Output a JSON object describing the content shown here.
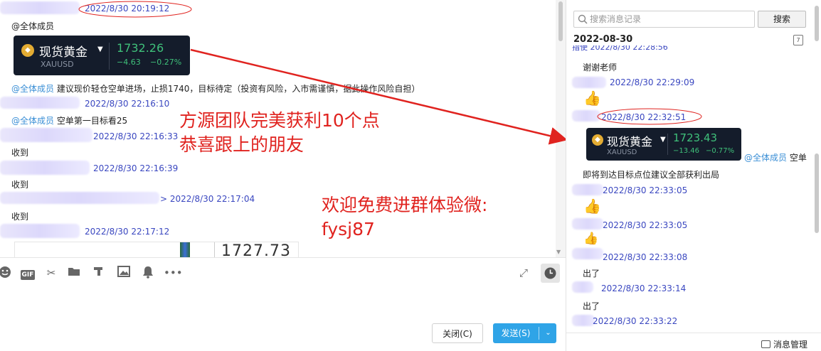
{
  "chat": {
    "messages": [
      {
        "time": "2022/8/30 20:19:12",
        "mention": "@全体成员"
      },
      {
        "mention": "@全体成员",
        "text": "建议现价轻仓空单进场，止损1740，目标待定（投资有风险，入市需谨慎，据此操作风险自担）",
        "time": "2022/8/30 22:16:10"
      },
      {
        "mention": "@全体成员",
        "text": "空单第一目标看25"
      },
      {
        "time": "2022/8/30 22:16:33",
        "text": "收到"
      },
      {
        "time": "2022/8/30 22:16:39",
        "text": "收到"
      },
      {
        "time": "> 2022/8/30 22:17:04",
        "text": "收到"
      },
      {
        "time": "2022/8/30 22:17:12",
        "partial_price": "1727.73"
      }
    ],
    "quote_card": {
      "name": "现货黄金",
      "symbol": "XAUUSD",
      "price": "1732.26",
      "change": "−4.63",
      "change_pct": "−0.27%"
    }
  },
  "overlay": {
    "line1": "方源团队完美获利10个点",
    "line2": "恭喜跟上的朋友",
    "line3": "欢迎免费进群体验微:",
    "line4": "fysj87"
  },
  "toolbar": {
    "icons": [
      "emoji-icon",
      "gif-icon",
      "scissors-icon",
      "folder-icon",
      "rich-text-icon",
      "image-icon",
      "bell-icon",
      "more-icon"
    ],
    "gif_label": "GIF"
  },
  "buttons": {
    "close": "关闭(C)",
    "send": "发送(S)"
  },
  "history": {
    "search_placeholder": "搜索消息记录",
    "search_button": "搜索",
    "date": "2022-08-30",
    "calendar_day": "7",
    "partial_top": "指使 2022/8/30 22:28:56",
    "messages": [
      {
        "text": "谢谢老师"
      },
      {
        "time": "2022/8/30 22:29:09",
        "emoji": "👍"
      },
      {
        "time": "2022/8/30 22:32:51"
      },
      {
        "mention": "@全体成员",
        "text": "空单",
        "text2": "即将到达目标点位建议全部获利出局"
      },
      {
        "time": "2022/8/30 22:33:05",
        "emoji": "👍"
      },
      {
        "time": "2022/8/30 22:33:05",
        "emoji": "👍"
      },
      {
        "time": "2022/8/30 22:33:08",
        "text": "出了"
      },
      {
        "time": "2022/8/30 22:33:14",
        "text": "出了"
      },
      {
        "time": "2022/8/30 22:33:22"
      }
    ],
    "quote_card": {
      "name": "现货黄金",
      "symbol": "XAUUSD",
      "price": "1723.43",
      "change": "−13.46",
      "change_pct": "−0.77%"
    },
    "message_manager": "消息管理"
  },
  "colors": {
    "accent_blue": "#2fa4e7",
    "annotation_red": "#e0231f",
    "price_green": "#3fc07a",
    "card_bg": "#141c2b"
  }
}
